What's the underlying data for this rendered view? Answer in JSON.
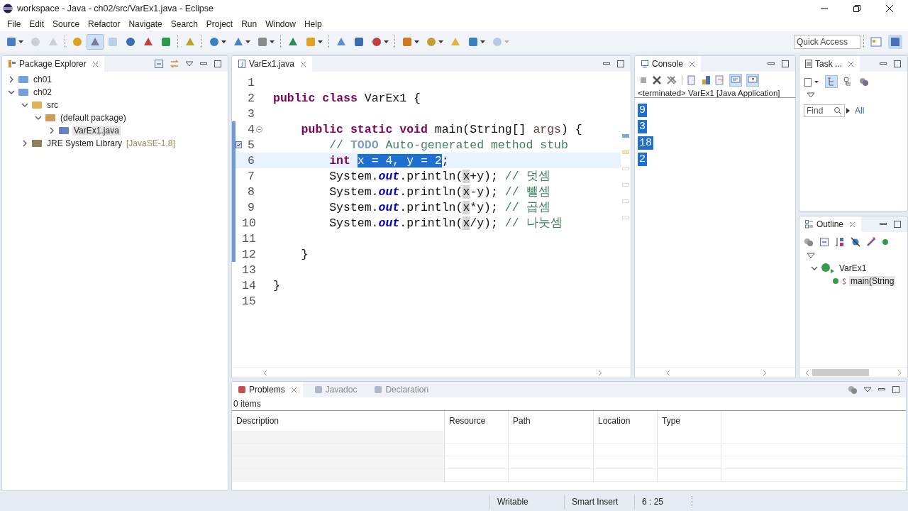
{
  "window": {
    "title": "workspace - Java - ch02/src/VarEx1.java - Eclipse"
  },
  "menu": [
    "File",
    "Edit",
    "Source",
    "Refactor",
    "Navigate",
    "Search",
    "Project",
    "Run",
    "Window",
    "Help"
  ],
  "toolbar": [
    {
      "kind": "split",
      "disabled": false,
      "selected": false
    },
    {
      "kind": "button",
      "disabled": true,
      "selected": false
    },
    {
      "kind": "button",
      "disabled": true,
      "selected": false
    },
    {
      "kind": "separator"
    },
    {
      "kind": "button",
      "disabled": false,
      "selected": false
    },
    {
      "kind": "button",
      "disabled": false,
      "selected": true
    },
    {
      "kind": "button",
      "disabled": true,
      "selected": false
    },
    {
      "kind": "button",
      "disabled": false,
      "selected": false
    },
    {
      "kind": "button",
      "disabled": false,
      "selected": false
    },
    {
      "kind": "button",
      "disabled": false,
      "selected": false
    },
    {
      "kind": "separator"
    },
    {
      "kind": "button",
      "disabled": false,
      "selected": false
    },
    {
      "kind": "separator"
    },
    {
      "kind": "split",
      "disabled": false,
      "selected": false
    },
    {
      "kind": "split",
      "disabled": false,
      "selected": false
    },
    {
      "kind": "split",
      "disabled": false,
      "selected": false
    },
    {
      "kind": "separator"
    },
    {
      "kind": "button",
      "disabled": false,
      "selected": false
    },
    {
      "kind": "split",
      "disabled": false,
      "selected": false
    },
    {
      "kind": "separator"
    },
    {
      "kind": "button",
      "disabled": false,
      "selected": false
    },
    {
      "kind": "button",
      "disabled": false,
      "selected": false
    },
    {
      "kind": "split",
      "disabled": false,
      "selected": false
    },
    {
      "kind": "separator"
    },
    {
      "kind": "split",
      "disabled": false,
      "selected": false
    },
    {
      "kind": "split",
      "disabled": false,
      "selected": false
    },
    {
      "kind": "button",
      "disabled": false,
      "selected": false
    },
    {
      "kind": "split",
      "disabled": false,
      "selected": false
    },
    {
      "kind": "split",
      "disabled": true,
      "selected": false
    }
  ],
  "quick_access": {
    "placeholder": "Quick Access"
  },
  "package_explorer": {
    "title": "Package Explorer",
    "tree": [
      {
        "label": "ch01",
        "kind": "project",
        "expanded": false,
        "selected": false
      },
      {
        "label": "ch02",
        "kind": "project",
        "expanded": true,
        "selected": false,
        "children": [
          {
            "label": "src",
            "kind": "folder",
            "expanded": true,
            "selected": false,
            "children": [
              {
                "label": "(default package)",
                "kind": "package",
                "expanded": true,
                "selected": false,
                "children": [
                  {
                    "label": "VarEx1.java",
                    "kind": "file",
                    "expanded": false,
                    "selected": true
                  }
                ]
              }
            ]
          },
          {
            "label": "JRE System Library",
            "suffix": "[JavaSE-1.8]",
            "kind": "library",
            "expanded": false,
            "selected": false
          }
        ]
      }
    ]
  },
  "editor": {
    "tab": {
      "label": "VarEx1.java"
    },
    "lines": [
      {
        "number": "1",
        "in_range": false,
        "current": false
      },
      {
        "number": "2",
        "in_range": false,
        "current": false,
        "tokens": [
          {
            "text": "public",
            "kind": "keyword"
          },
          {
            "text": " class",
            "kind": "keyword"
          },
          {
            "text": " VarEx1 {",
            "kind": "plain"
          }
        ]
      },
      {
        "number": "3",
        "in_range": false,
        "current": false
      },
      {
        "number": "4",
        "in_range": true,
        "current": false,
        "fold": true,
        "tokens": [
          {
            "text": "    public",
            "kind": "keyword"
          },
          {
            "text": " static",
            "kind": "keyword"
          },
          {
            "text": " void",
            "kind": "keyword"
          },
          {
            "text": " main(String[] ",
            "kind": "plain"
          },
          {
            "text": "args",
            "kind": "param"
          },
          {
            "text": ") {",
            "kind": "plain"
          }
        ]
      },
      {
        "number": "5",
        "in_range": true,
        "current": false,
        "task": true,
        "tokens": [
          {
            "text": "        // ",
            "kind": "comment"
          },
          {
            "text": "TODO",
            "kind": "todo"
          },
          {
            "text": " Auto-generated method stub",
            "kind": "comment"
          }
        ]
      },
      {
        "number": "6",
        "in_range": true,
        "current": true,
        "tokens": [
          {
            "text": "        int ",
            "kind": "keyword"
          },
          {
            "text": "x = 4, y = 2",
            "kind": "selection"
          },
          {
            "text": ";",
            "kind": "plain"
          }
        ]
      },
      {
        "number": "7",
        "in_range": true,
        "current": false,
        "tokens": [
          {
            "text": "        System.",
            "kind": "plain"
          },
          {
            "text": "out",
            "kind": "field"
          },
          {
            "text": ".println(",
            "kind": "plain"
          },
          {
            "text": "x",
            "kind": "occurrence"
          },
          {
            "text": "+y); ",
            "kind": "plain"
          },
          {
            "text": "// 덧셈",
            "kind": "comment"
          }
        ]
      },
      {
        "number": "8",
        "in_range": true,
        "current": false,
        "tokens": [
          {
            "text": "        System.",
            "kind": "plain"
          },
          {
            "text": "out",
            "kind": "field"
          },
          {
            "text": ".println(",
            "kind": "plain"
          },
          {
            "text": "x",
            "kind": "occurrence"
          },
          {
            "text": "-y); ",
            "kind": "plain"
          },
          {
            "text": "// 뺄셈",
            "kind": "comment"
          }
        ]
      },
      {
        "number": "9",
        "in_range": true,
        "current": false,
        "tokens": [
          {
            "text": "        System.",
            "kind": "plain"
          },
          {
            "text": "out",
            "kind": "field"
          },
          {
            "text": ".println(",
            "kind": "plain"
          },
          {
            "text": "x",
            "kind": "occurrence"
          },
          {
            "text": "*y); ",
            "kind": "plain"
          },
          {
            "text": "// 곱셈",
            "kind": "comment"
          }
        ]
      },
      {
        "number": "10",
        "in_range": true,
        "current": false,
        "tokens": [
          {
            "text": "        System.",
            "kind": "plain"
          },
          {
            "text": "out",
            "kind": "field"
          },
          {
            "text": ".println(",
            "kind": "plain"
          },
          {
            "text": "x",
            "kind": "occurrence"
          },
          {
            "text": "/y); ",
            "kind": "plain"
          },
          {
            "text": "// 나눗셈",
            "kind": "comment"
          }
        ]
      },
      {
        "number": "11",
        "in_range": true,
        "current": false
      },
      {
        "number": "12",
        "in_range": true,
        "current": false,
        "tokens": [
          {
            "text": "    }",
            "kind": "plain"
          }
        ]
      },
      {
        "number": "13",
        "in_range": false,
        "current": false
      },
      {
        "number": "14",
        "in_range": false,
        "current": false,
        "tokens": [
          {
            "text": "}",
            "kind": "plain"
          }
        ]
      },
      {
        "number": "15",
        "in_range": false,
        "current": false
      }
    ]
  },
  "console": {
    "title": "Console",
    "status": "<terminated> VarEx1 [Java Application]",
    "output_selected": true,
    "output": [
      "9",
      "3",
      "18",
      "2"
    ]
  },
  "task_list": {
    "title": "Task ...",
    "find": {
      "placeholder": "Find"
    },
    "links": [
      "All"
    ]
  },
  "outline": {
    "title": "Outline",
    "tree": [
      {
        "label": "VarEx1",
        "kind": "class",
        "expanded": true,
        "selected": false,
        "children": [
          {
            "label": "main(String",
            "kind": "method",
            "static": true,
            "selected": true
          }
        ]
      }
    ]
  },
  "problems": {
    "tabs": [
      {
        "label": "Problems",
        "selected": true
      },
      {
        "label": "Javadoc",
        "selected": false
      },
      {
        "label": "Declaration",
        "selected": false
      }
    ],
    "summary": "0 items",
    "columns": [
      "Description",
      "Resource",
      "Path",
      "Location",
      "Type"
    ]
  },
  "status_bar": [
    "Writable",
    "Smart Insert",
    "6 : 25"
  ]
}
